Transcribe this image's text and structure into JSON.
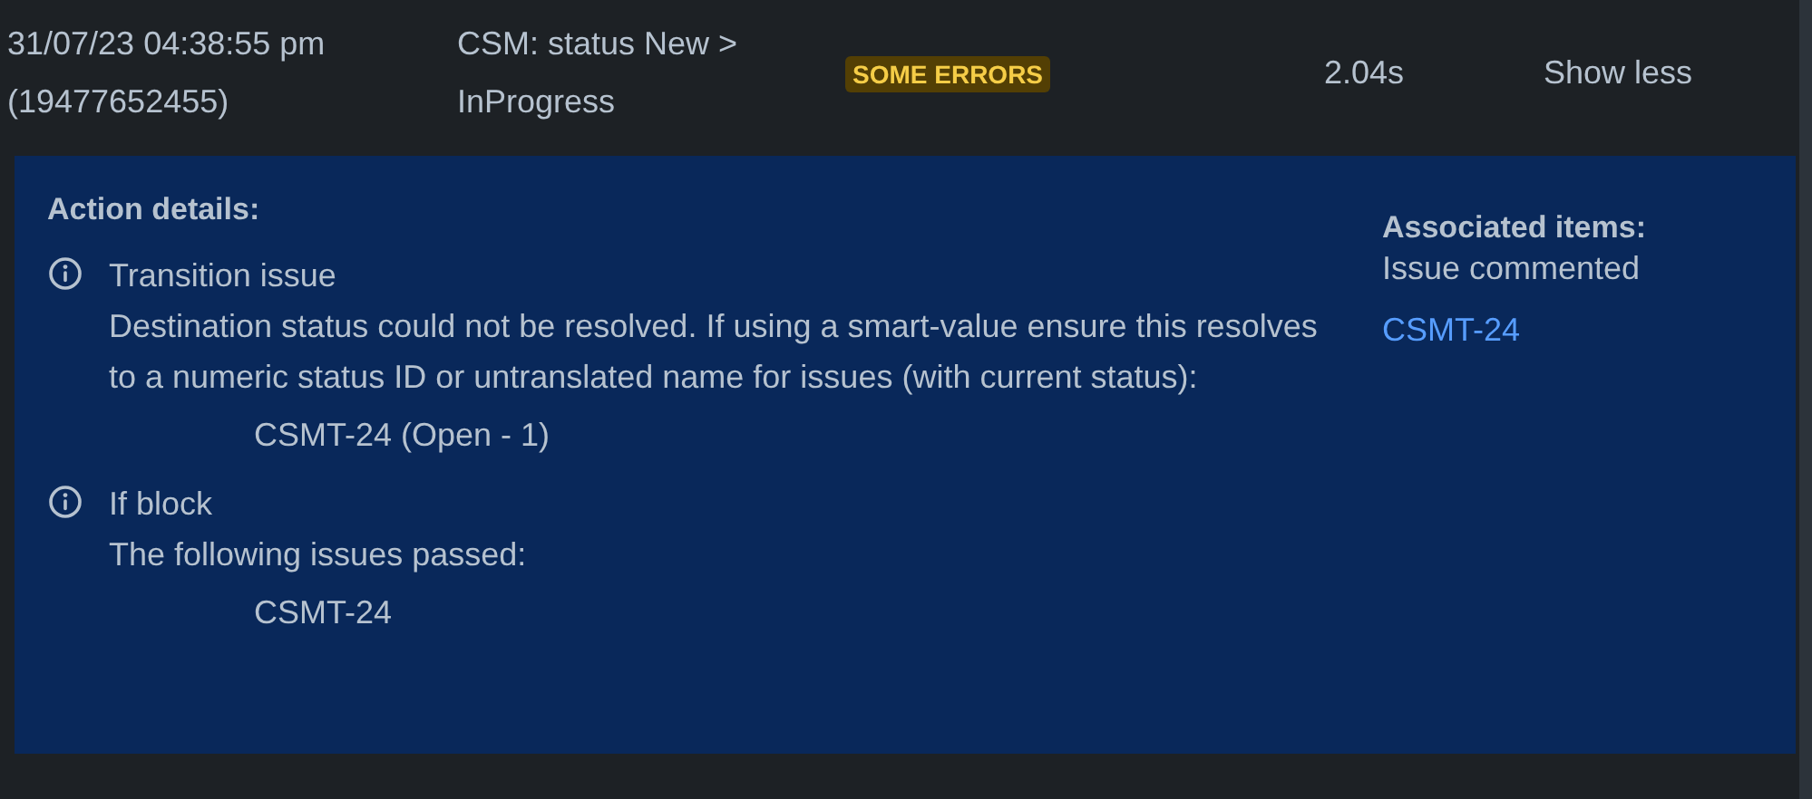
{
  "row": {
    "date": "31/07/23 04:38:55 pm",
    "id": "(19477652455)",
    "rule_line_1": "CSM: status New >",
    "rule_line_2": "InProgress",
    "status": "SOME ERRORS",
    "duration": "2.04s",
    "toggle": "Show less"
  },
  "details": {
    "title": "Action details:",
    "actions": [
      {
        "name": "Transition issue",
        "message": "Destination status could not be resolved. If using a smart-value ensure this resolves to a numeric status ID or untranslated name for issues (with current status):",
        "items": [
          "CSMT-24 (Open - 1)"
        ]
      },
      {
        "name": "If block",
        "message": "The following issues passed:",
        "items": [
          "CSMT-24"
        ]
      }
    ]
  },
  "associated": {
    "title": "Associated items:",
    "subtitle": "Issue commented",
    "links": [
      "CSMT-24"
    ]
  }
}
